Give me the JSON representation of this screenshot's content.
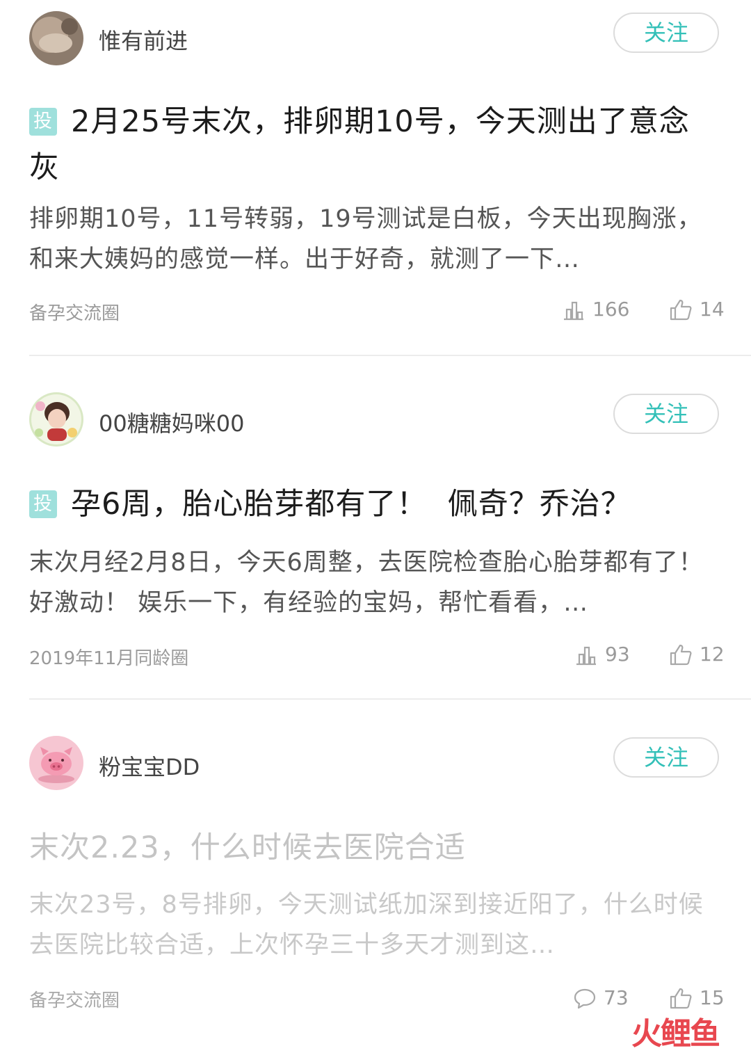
{
  "posts": [
    {
      "user": "惟有前进",
      "follow": "关注",
      "tag": "投",
      "title": "2月25号末次，排卵期10号，今天测出了意念灰",
      "excerpt": "排卵期10号，11号转弱，19号测试是白板，今天出现胸涨，和来大姨妈的感觉一样。出于好奇，就测了一下…",
      "circle": "备孕交流圈",
      "views": "166",
      "likes": "14",
      "views_icon": "bar-chart-icon",
      "likes_icon": "thumbs-up-icon"
    },
    {
      "user": "00糖糖妈咪00",
      "follow": "关注",
      "tag": "投",
      "title": "孕6周，胎心胎芽都有了！  佩奇？乔治？",
      "excerpt": "末次月经2月8日，今天6周整，去医院检查胎心胎芽都有了！好激动！ 娱乐一下，有经验的宝妈，帮忙看看，…",
      "circle": "2019年11月同龄圈",
      "views": "93",
      "likes": "12",
      "views_icon": "bar-chart-icon",
      "likes_icon": "thumbs-up-icon"
    },
    {
      "user": "粉宝宝DD",
      "follow": "关注",
      "title": "末次2.23，什么时候去医院合适",
      "excerpt": "末次23号，8号排卵，今天测试纸加深到接近阳了，什么时候去医院比较合适，上次怀孕三十多天才测到这…",
      "circle": "备孕交流圈",
      "comments": "73",
      "likes": "15",
      "comments_icon": "comment-bubble-icon",
      "likes_icon": "thumbs-up-icon"
    }
  ],
  "watermark": "火鲤鱼",
  "colors": {
    "accent": "#33c0b8",
    "tag_bg": "#9fe0dc",
    "watermark": "#e8474f"
  }
}
